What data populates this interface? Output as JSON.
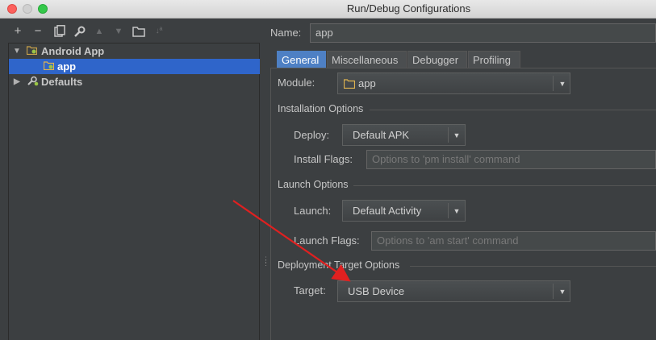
{
  "window": {
    "title": "Run/Debug Configurations"
  },
  "toolbar": {
    "add": "+",
    "remove": "−",
    "copy": "⧉",
    "settings": "🔧",
    "up": "▲",
    "down": "▼",
    "folder": "▭",
    "sort": "↓ª"
  },
  "tree": {
    "android_app": "Android App",
    "app": "app",
    "defaults": "Defaults"
  },
  "name": {
    "label": "Name:",
    "value": "app"
  },
  "tabs": [
    {
      "label": "General",
      "active": true
    },
    {
      "label": "Miscellaneous",
      "active": false
    },
    {
      "label": "Debugger",
      "active": false
    },
    {
      "label": "Profiling",
      "active": false
    }
  ],
  "module": {
    "label": "Module:",
    "value": "app"
  },
  "installation": {
    "title": "Installation Options",
    "deploy_label": "Deploy:",
    "deploy_value": "Default APK",
    "flags_label": "Install Flags:",
    "flags_placeholder": "Options to 'pm install' command"
  },
  "launch": {
    "title": "Launch Options",
    "launch_label": "Launch:",
    "launch_value": "Default Activity",
    "flags_label": "Launch Flags:",
    "flags_placeholder": "Options to 'am start' command"
  },
  "deployment": {
    "title": "Deployment Target Options",
    "target_label": "Target:",
    "target_value": "USB Device"
  },
  "colors": {
    "background": "#3c3f41",
    "selection": "#2f65ca",
    "tab_active": "#4e80c4",
    "annotation_arrow": "#e02020"
  }
}
